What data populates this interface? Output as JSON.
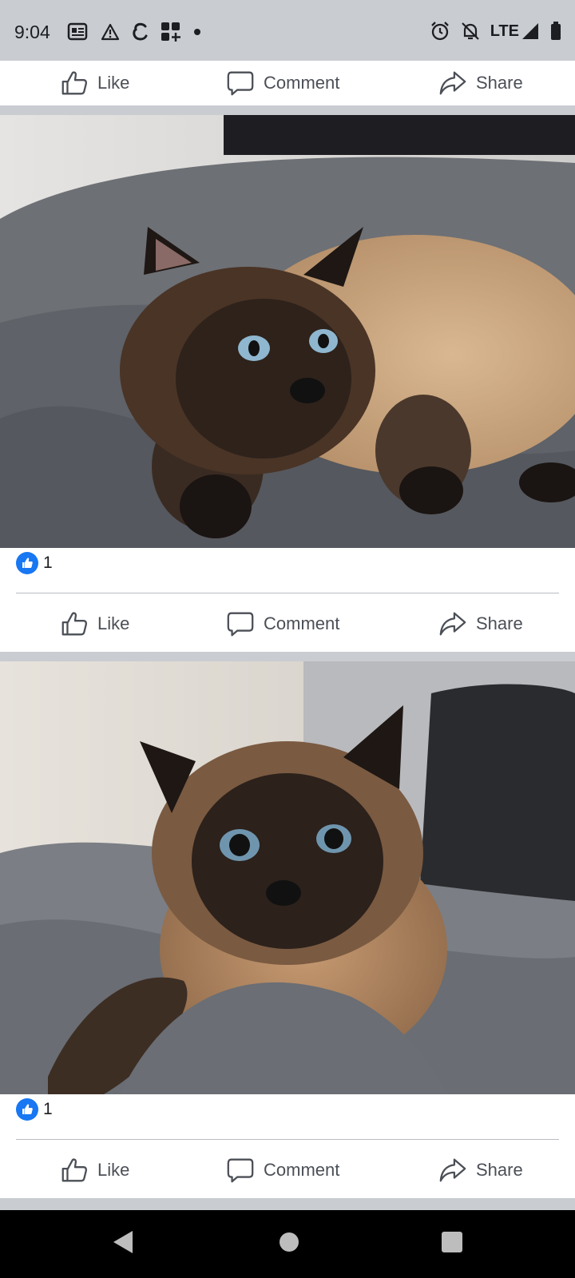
{
  "status_bar": {
    "time": "9:04",
    "network": "LTE",
    "left_icons": [
      "news-icon",
      "warning-icon",
      "epsilon-icon",
      "apps-icon",
      "dot-icon"
    ],
    "right_icons": [
      "alarm-icon",
      "muted-bell-icon",
      "signal-icon",
      "battery-icon"
    ]
  },
  "actions": {
    "like_label": "Like",
    "comment_label": "Comment",
    "share_label": "Share"
  },
  "posts": [
    {
      "reaction_count": "1",
      "photo": "tortoiseshell siamese cat lying on grey bedding"
    },
    {
      "reaction_count": "1",
      "photo": "tortoiseshell siamese cat looking at camera on grey blanket"
    }
  ],
  "colors": {
    "like_blue": "#1877f2",
    "feed_background": "#c9ccd1",
    "action_text": "#4b4f56"
  },
  "nav_bar": {
    "buttons": [
      "back-icon",
      "home-icon",
      "recents-icon"
    ]
  }
}
